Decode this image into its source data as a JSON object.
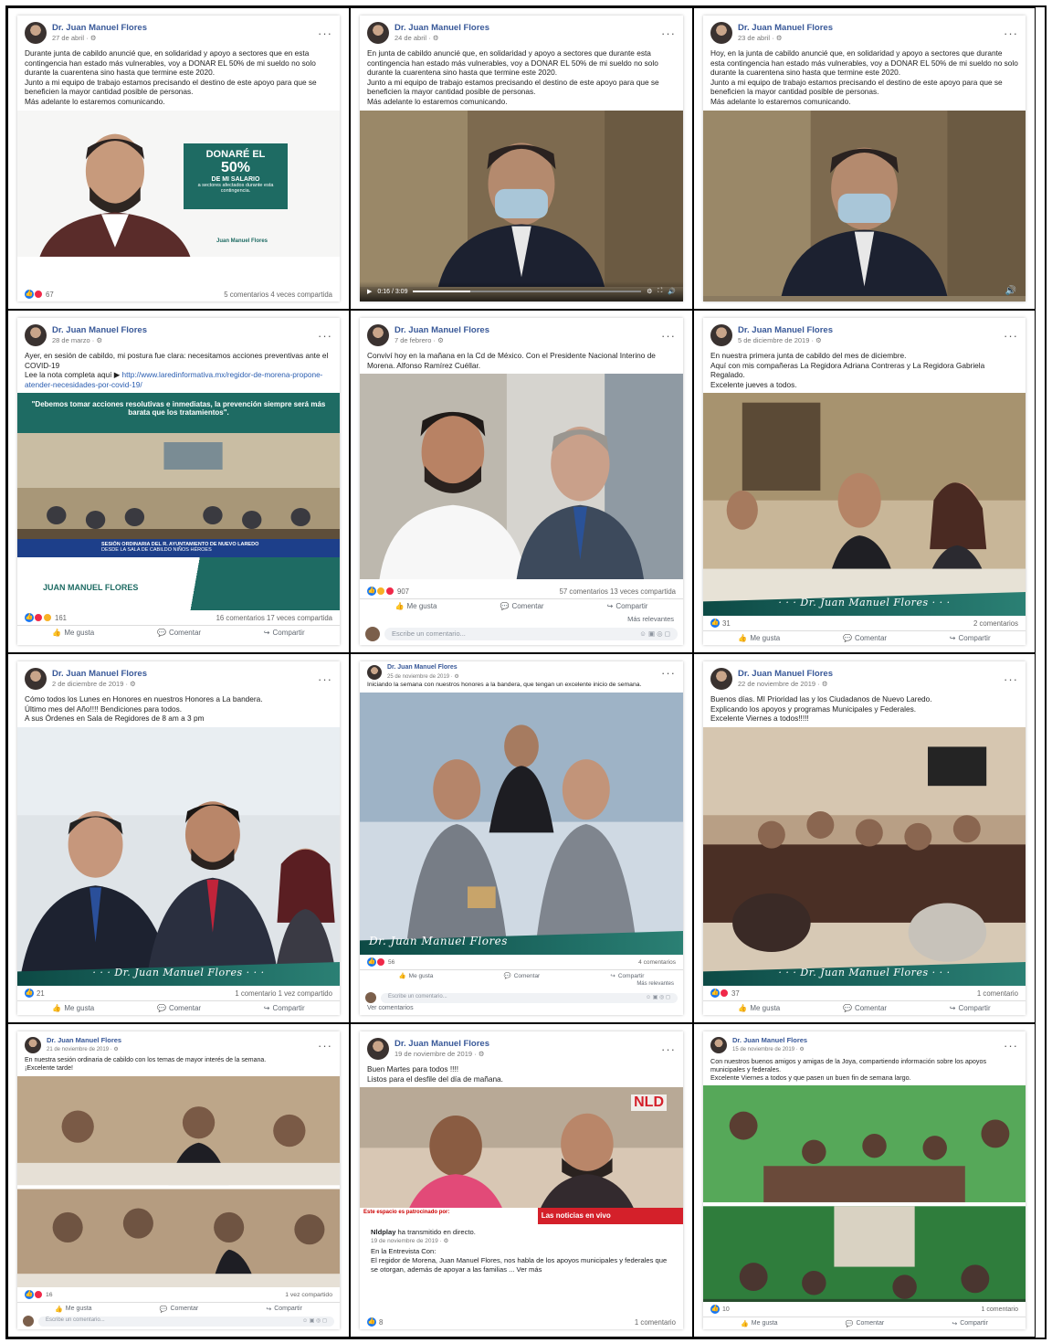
{
  "posts": [
    {
      "author": "Dr. Juan Manuel Flores",
      "date": "27 de abril · ⚙",
      "text": "Durante junta de cabildo anuncié que, en solidaridad y apoyo a sectores que en esta contingencia han estado más vulnerables, voy a DONAR EL 50% de mi sueldo no solo durante la cuarentena sino hasta que termine este 2020.\nJunto a mi equipo de trabajo estamos precisando el destino de este apoyo para que se beneficien la mayor cantidad posible de personas.\nMás adelante lo estaremos comunicando.",
      "image_banner": {
        "line1": "DONARÉ EL",
        "line2": "50%",
        "line3": "DE MI SALARIO",
        "line4": "a sectores afectados durante esta contingencia."
      },
      "logo_text": "Juan Manuel Flores",
      "reactions": "67",
      "stats_right": "5 comentarios  4 veces compartida"
    },
    {
      "author": "Dr. Juan Manuel Flores",
      "date": "24 de abril · ⚙",
      "text": "En junta de cabildo anuncié que, en solidaridad y apoyo a sectores que durante esta contingencia han estado más vulnerables, voy a DONAR EL 50% de mi sueldo no solo durante la cuarentena sino hasta que termine este 2020.\nJunto a mi equipo de trabajo estamos precisando el destino de este apoyo para que se beneficien la mayor cantidad posible de personas.\nMás adelante lo estaremos comunicando.",
      "video_time": "0:16 / 3:09"
    },
    {
      "author": "Dr. Juan Manuel Flores",
      "date": "23 de abril · ⚙",
      "text": "Hoy, en la junta de cabildo anuncié que, en solidaridad y apoyo a sectores que durante esta contingencia han estado más vulnerables, voy a DONAR EL 50% de mi sueldo no solo durante la cuarentena sino hasta que termine este 2020.\nJunto a mi equipo de trabajo estamos precisando el destino de este apoyo para que se beneficien la mayor cantidad posible de personas.\nMás adelante lo estaremos comunicando."
    },
    {
      "author": "Dr. Juan Manuel Flores",
      "date": "28 de marzo · ⚙",
      "text": "Ayer, en sesión de cabildo, mi postura fue clara: necesitamos acciones preventivas ante el COVID-19\nLee la nota completa aquí ▶ ",
      "link": "http://www.laredinformativa.mx/regidor-de-morena-propone-atender-necesidades-por-covid-19/",
      "banner_quote": "\"Debemos tomar acciones resolutivas e inmediatas, la prevención siempre será más barata que los tratamientos\".",
      "lower_third": "SESIÓN ORDINARIA DEL R. AYUNTAMIENTO DE NUEVO LAREDO",
      "lower_third_sub": "DESDE LA SALA DE CABILDO NIÑOS HÉROES",
      "logo_text": "JUAN MANUEL FLORES",
      "reactions": "161",
      "stats_right": "16 comentarios  17 veces compartida"
    },
    {
      "author": "Dr. Juan Manuel Flores",
      "date": "7 de febrero · ⚙",
      "text": "Conviví hoy en la mañana en la Cd de México. Con el Presidente Nacional Interino de Morena. Alfonso Ramírez Cuéllar.",
      "reactions": "907",
      "stats_right": "57 comentarios  13 veces compartida",
      "relevant": "Más relevantes",
      "comment_placeholder": "Escribe un comentario..."
    },
    {
      "author": "Dr. Juan Manuel Flores",
      "date": "5 de diciembre de 2019 · ⚙",
      "text": "En nuestra primera junta de cabildo del mes de diciembre.\nAquí con mis compañeras La Regidora Adriana Contreras y La Regidora Gabriela Regalado.\nExcelente jueves a todos.",
      "signature": "· · ·  Dr. Juan Manuel Flores  · · ·",
      "reactions": "31",
      "stats_right": "2 comentarios"
    },
    {
      "author": "Dr. Juan Manuel Flores",
      "date": "2 de diciembre de 2019 · ⚙",
      "text": "Cómo todos los Lunes en Honores en nuestros Honores a La bandera.\nÚltimo mes del Año!!!! Bendiciones para todos.\nA sus Órdenes en Sala de Regidores de 8 am a 3 pm",
      "signature": "· · ·  Dr. Juan Manuel Flores  · · ·",
      "reactions": "21",
      "stats_right": "1 comentario  1 vez compartido"
    },
    {
      "author": "Dr. Juan Manuel Flores",
      "date": "25 de noviembre de 2019 · ⚙",
      "text": "Iniciando la semana con nuestros honores a la bandera, que tengan un excelente inicio de semana.",
      "signature": "Dr. Juan Manuel Flores",
      "reactions": "56",
      "stats_right": "4 comentarios",
      "relevant": "Más relevantes",
      "comment_placeholder": "Escribe un comentario...",
      "more_comments": "Ver comentarios"
    },
    {
      "author": "Dr. Juan Manuel Flores",
      "date": "22 de noviembre de 2019 · ⚙",
      "text": "Buenos días. MI Prioridad las y los Ciudadanos de Nuevo Laredo.\nExplicando los apoyos y programas Municipales y Federales.\nExcelente Viernes a todos!!!!!",
      "signature": "· · ·  Dr. Juan Manuel Flores  · · ·",
      "reactions": "37",
      "stats_right": "1 comentario"
    },
    {
      "author": "Dr. Juan Manuel Flores",
      "date": "21 de noviembre de 2019 · ⚙",
      "text": "En nuestra sesión ordinaria de cabildo con los temas de mayor interés de la semana.\n¡Excelente tarde!",
      "reactions": "16",
      "stats_right": "1 vez compartido",
      "comment_placeholder": "Escribe un comentario..."
    },
    {
      "author": "Dr. Juan Manuel Flores",
      "date": "19 de noviembre de 2019 · ⚙",
      "text": "Buen Martes para todos !!!!\nListos para el desfile del día de mañana.",
      "brand": "NLD",
      "ticker_left": "Este espacio es patrocinado por:",
      "ticker_right": "Las noticias en vivo",
      "shared_author": "Nldplay",
      "shared_action": " ha transmitido en directo.",
      "shared_date": "19 de noviembre de 2019 · ⚙",
      "shared_text": "En la Entrevista Con:\nEl regidor de Morena, Juan Manuel Flores, nos habla de los apoyos municipales y federales que se otorgan, además de apoyar a las familias ... Ver más",
      "reactions": "8",
      "stats_right": "1 comentario"
    },
    {
      "author": "Dr. Juan Manuel Flores",
      "date": "15 de noviembre de 2019 · ⚙",
      "text": "Con nuestros buenos amigos y amigas de la Joya, compartiendo información sobre los apoyos municipales y federales.\nExcelente Viernes a todos y que pasen un buen fin de semana largo.",
      "reactions": "10",
      "stats_right": "1 comentario"
    }
  ],
  "labels": {
    "like": "Me gusta",
    "comment": "Comentar",
    "share": "Compartir"
  },
  "colors": {
    "fb_blue": "#1877f2",
    "name_blue": "#385898",
    "teal": "#1e6b63"
  }
}
